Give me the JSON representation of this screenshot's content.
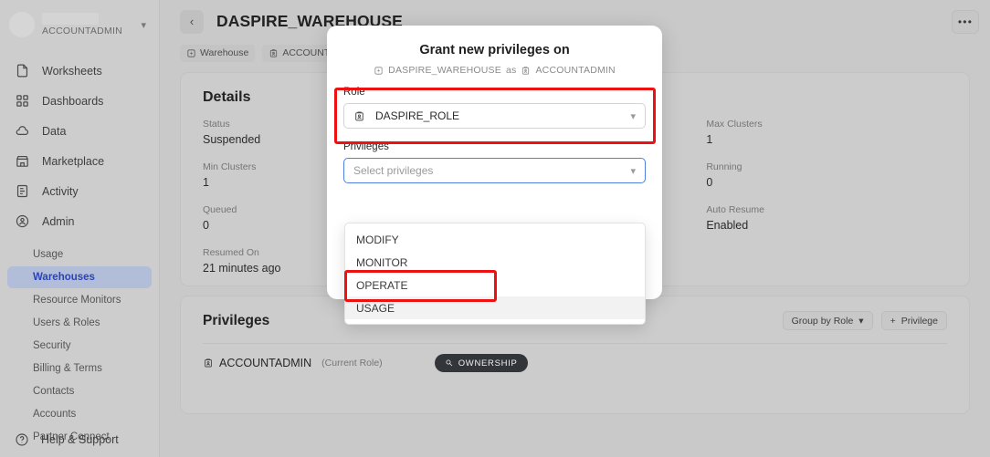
{
  "sidebar": {
    "account": {
      "role": "ACCOUNTADMIN",
      "chevron": "chevron-down-icon"
    },
    "items": [
      {
        "label": "Worksheets",
        "icon": "worksheets-icon"
      },
      {
        "label": "Dashboards",
        "icon": "dashboards-icon"
      },
      {
        "label": "Data",
        "icon": "data-cloud-icon"
      },
      {
        "label": "Marketplace",
        "icon": "marketplace-icon"
      },
      {
        "label": "Activity",
        "icon": "activity-icon"
      },
      {
        "label": "Admin",
        "icon": "admin-shield-icon"
      }
    ],
    "subitems": [
      {
        "label": "Usage",
        "active": false
      },
      {
        "label": "Warehouses",
        "active": true
      },
      {
        "label": "Resource Monitors",
        "active": false
      },
      {
        "label": "Users & Roles",
        "active": false
      },
      {
        "label": "Security",
        "active": false
      },
      {
        "label": "Billing & Terms",
        "active": false
      },
      {
        "label": "Contacts",
        "active": false
      },
      {
        "label": "Accounts",
        "active": false
      },
      {
        "label": "Partner Connect",
        "active": false
      }
    ],
    "help": {
      "label": "Help & Support",
      "icon": "help-circle-icon"
    },
    "active_color": "#2a44b8",
    "active_bg": "#b2bdda"
  },
  "topbar": {
    "back_label": "‹",
    "title": "DASPIRE_WAREHOUSE",
    "more_label": "•••"
  },
  "breadcrumb": [
    {
      "label": "Warehouse",
      "icon": "warehouse-icon"
    },
    {
      "label": "ACCOUNTAD",
      "icon": "role-badge-icon"
    }
  ],
  "details": {
    "title": "Details",
    "columns": [
      [
        {
          "label": "Status",
          "value": "Suspended"
        },
        {
          "label": "Min Clusters",
          "value": "1"
        },
        {
          "label": "Queued",
          "value": "0"
        },
        {
          "label": "Resumed On",
          "value": "21 minutes ago"
        }
      ],
      [],
      [
        {
          "label": "Max Clusters",
          "value": "1"
        },
        {
          "label": "Running",
          "value": "0"
        },
        {
          "label": "Auto Resume",
          "value": "Enabled"
        }
      ]
    ]
  },
  "privileges_panel": {
    "title": "Privileges",
    "group_by_label": "Group by Role",
    "group_by_chevron": "chevron-down-icon",
    "add_label": "Privilege",
    "add_icon": "plus-icon",
    "rows": [
      {
        "role": "ACCOUNTADMIN",
        "role_icon": "role-badge-icon",
        "note": "(Current Role)",
        "badge": "OWNERSHIP",
        "badge_icon": "key-icon"
      }
    ]
  },
  "modal": {
    "title": "Grant new privileges on",
    "subject": "DASPIRE_WAREHOUSE",
    "subject_icon": "warehouse-icon",
    "connector": "as",
    "actor": "ACCOUNTADMIN",
    "actor_icon": "role-badge-icon",
    "role_field": {
      "label": "Role",
      "value": "DASPIRE_ROLE",
      "icon": "role-badge-icon",
      "chevron": "chevron-down-icon"
    },
    "privileges_field": {
      "label": "Privileges",
      "placeholder": "Select privileges",
      "value": "",
      "chevron": "chevron-down-icon"
    },
    "dropdown_options": [
      {
        "label": "MODIFY",
        "hovered": false
      },
      {
        "label": "MONITOR",
        "hovered": false
      },
      {
        "label": "OPERATE",
        "hovered": false
      },
      {
        "label": "USAGE",
        "hovered": true
      }
    ]
  },
  "annotations": {
    "color": "#ee1111",
    "boxes": [
      {
        "name": "role-field-highlight"
      },
      {
        "name": "usage-option-highlight"
      }
    ]
  }
}
